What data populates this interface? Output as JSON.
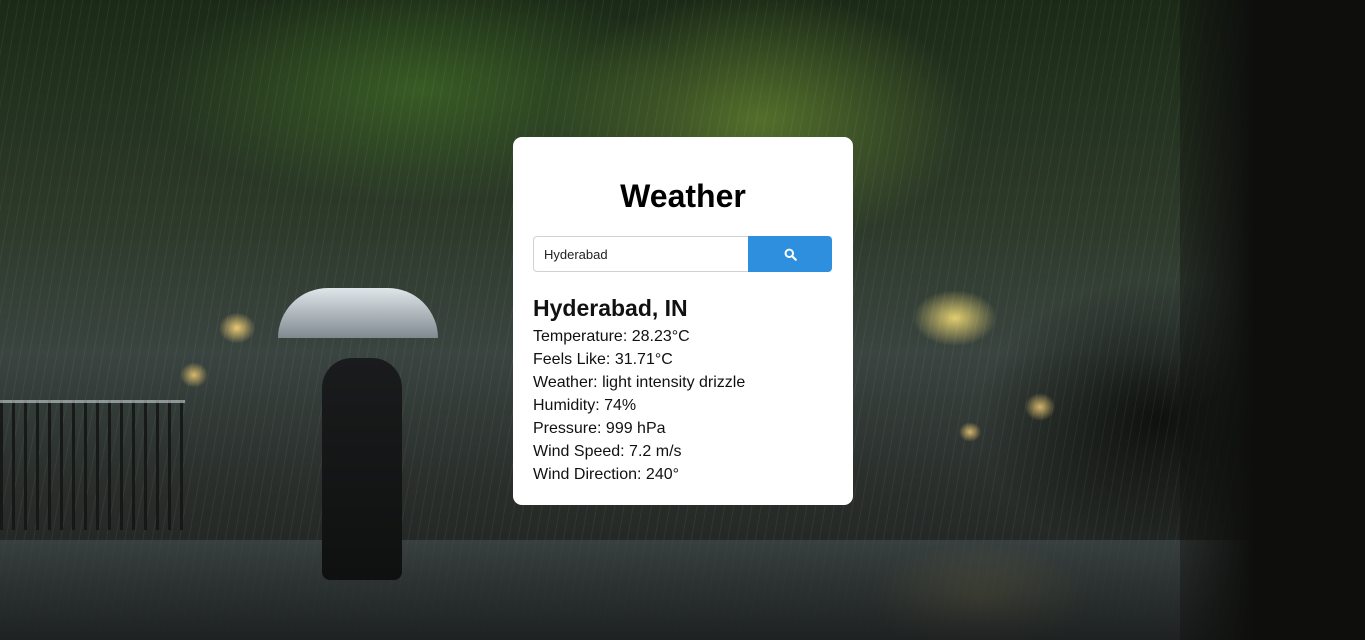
{
  "app": {
    "title": "Weather"
  },
  "search": {
    "value": "Hyderabad",
    "button_icon": "search-icon"
  },
  "result": {
    "city": "Hyderabad, IN",
    "temperature": "Temperature: 28.23°C",
    "feels_like": "Feels Like: 31.71°C",
    "weather": "Weather: light intensity drizzle",
    "humidity": "Humidity: 74%",
    "pressure": "Pressure: 999 hPa",
    "wind_speed": "Wind Speed: 7.2 m/s",
    "wind_direction": "Wind Direction: 240°"
  },
  "colors": {
    "accent": "#2e8fde",
    "card": "#ffffff"
  }
}
